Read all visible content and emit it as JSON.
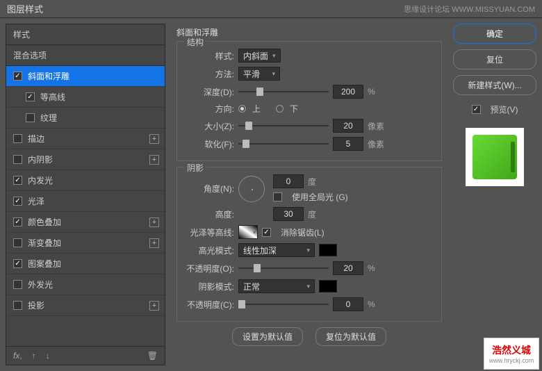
{
  "dialog": {
    "title": "图层样式",
    "watermark": "思缘设计论坛  WWW.MISSYUAN.COM"
  },
  "left": {
    "styles_header": "样式",
    "blend_options": "混合选项",
    "items": [
      {
        "label": "斜面和浮雕",
        "checked": true,
        "active": true
      },
      {
        "label": "等高线",
        "checked": true,
        "sub": true
      },
      {
        "label": "纹理",
        "checked": false,
        "sub": true
      },
      {
        "label": "描边",
        "checked": false,
        "plus": true
      },
      {
        "label": "内阴影",
        "checked": false,
        "plus": true
      },
      {
        "label": "内发光",
        "checked": true
      },
      {
        "label": "光泽",
        "checked": true
      },
      {
        "label": "颜色叠加",
        "checked": true,
        "plus": true
      },
      {
        "label": "渐变叠加",
        "checked": false,
        "plus": true
      },
      {
        "label": "图案叠加",
        "checked": true
      },
      {
        "label": "外发光",
        "checked": false
      },
      {
        "label": "投影",
        "checked": false,
        "plus": true
      }
    ],
    "fx": "fx"
  },
  "center": {
    "title": "斜面和浮雕",
    "structure": {
      "legend": "结构",
      "style_label": "样式:",
      "style_value": "内斜面",
      "method_label": "方法:",
      "method_value": "平滑",
      "depth_label": "深度(D):",
      "depth_value": "200",
      "depth_unit": "%",
      "direction_label": "方向:",
      "up": "上",
      "down": "下",
      "size_label": "大小(Z):",
      "size_value": "20",
      "size_unit": "像素",
      "soften_label": "软化(F):",
      "soften_value": "5",
      "soften_unit": "像素"
    },
    "shading": {
      "legend": "阴影",
      "angle_label": "角度(N):",
      "angle_value": "0",
      "angle_unit": "度",
      "global_label": "使用全局光 (G)",
      "altitude_label": "高度:",
      "altitude_value": "30",
      "altitude_unit": "度",
      "gloss_label": "光泽等高线:",
      "antialias_label": "消除锯齿(L)",
      "highlight_mode_label": "高光模式:",
      "highlight_mode_value": "线性加深",
      "hl_opacity_label": "不透明度(O):",
      "hl_opacity_value": "20",
      "hl_opacity_unit": "%",
      "shadow_mode_label": "阴影模式:",
      "shadow_mode_value": "正常",
      "sh_opacity_label": "不透明度(C):",
      "sh_opacity_value": "0",
      "sh_opacity_unit": "%"
    },
    "buttons": {
      "default": "设置为默认值",
      "reset": "复位为默认值"
    }
  },
  "right": {
    "ok": "确定",
    "cancel": "复位",
    "new_style": "新建样式(W)...",
    "preview_label": "预览(V)"
  },
  "corner": {
    "brand": "浩然义城",
    "url": "www.hryckj.com"
  }
}
